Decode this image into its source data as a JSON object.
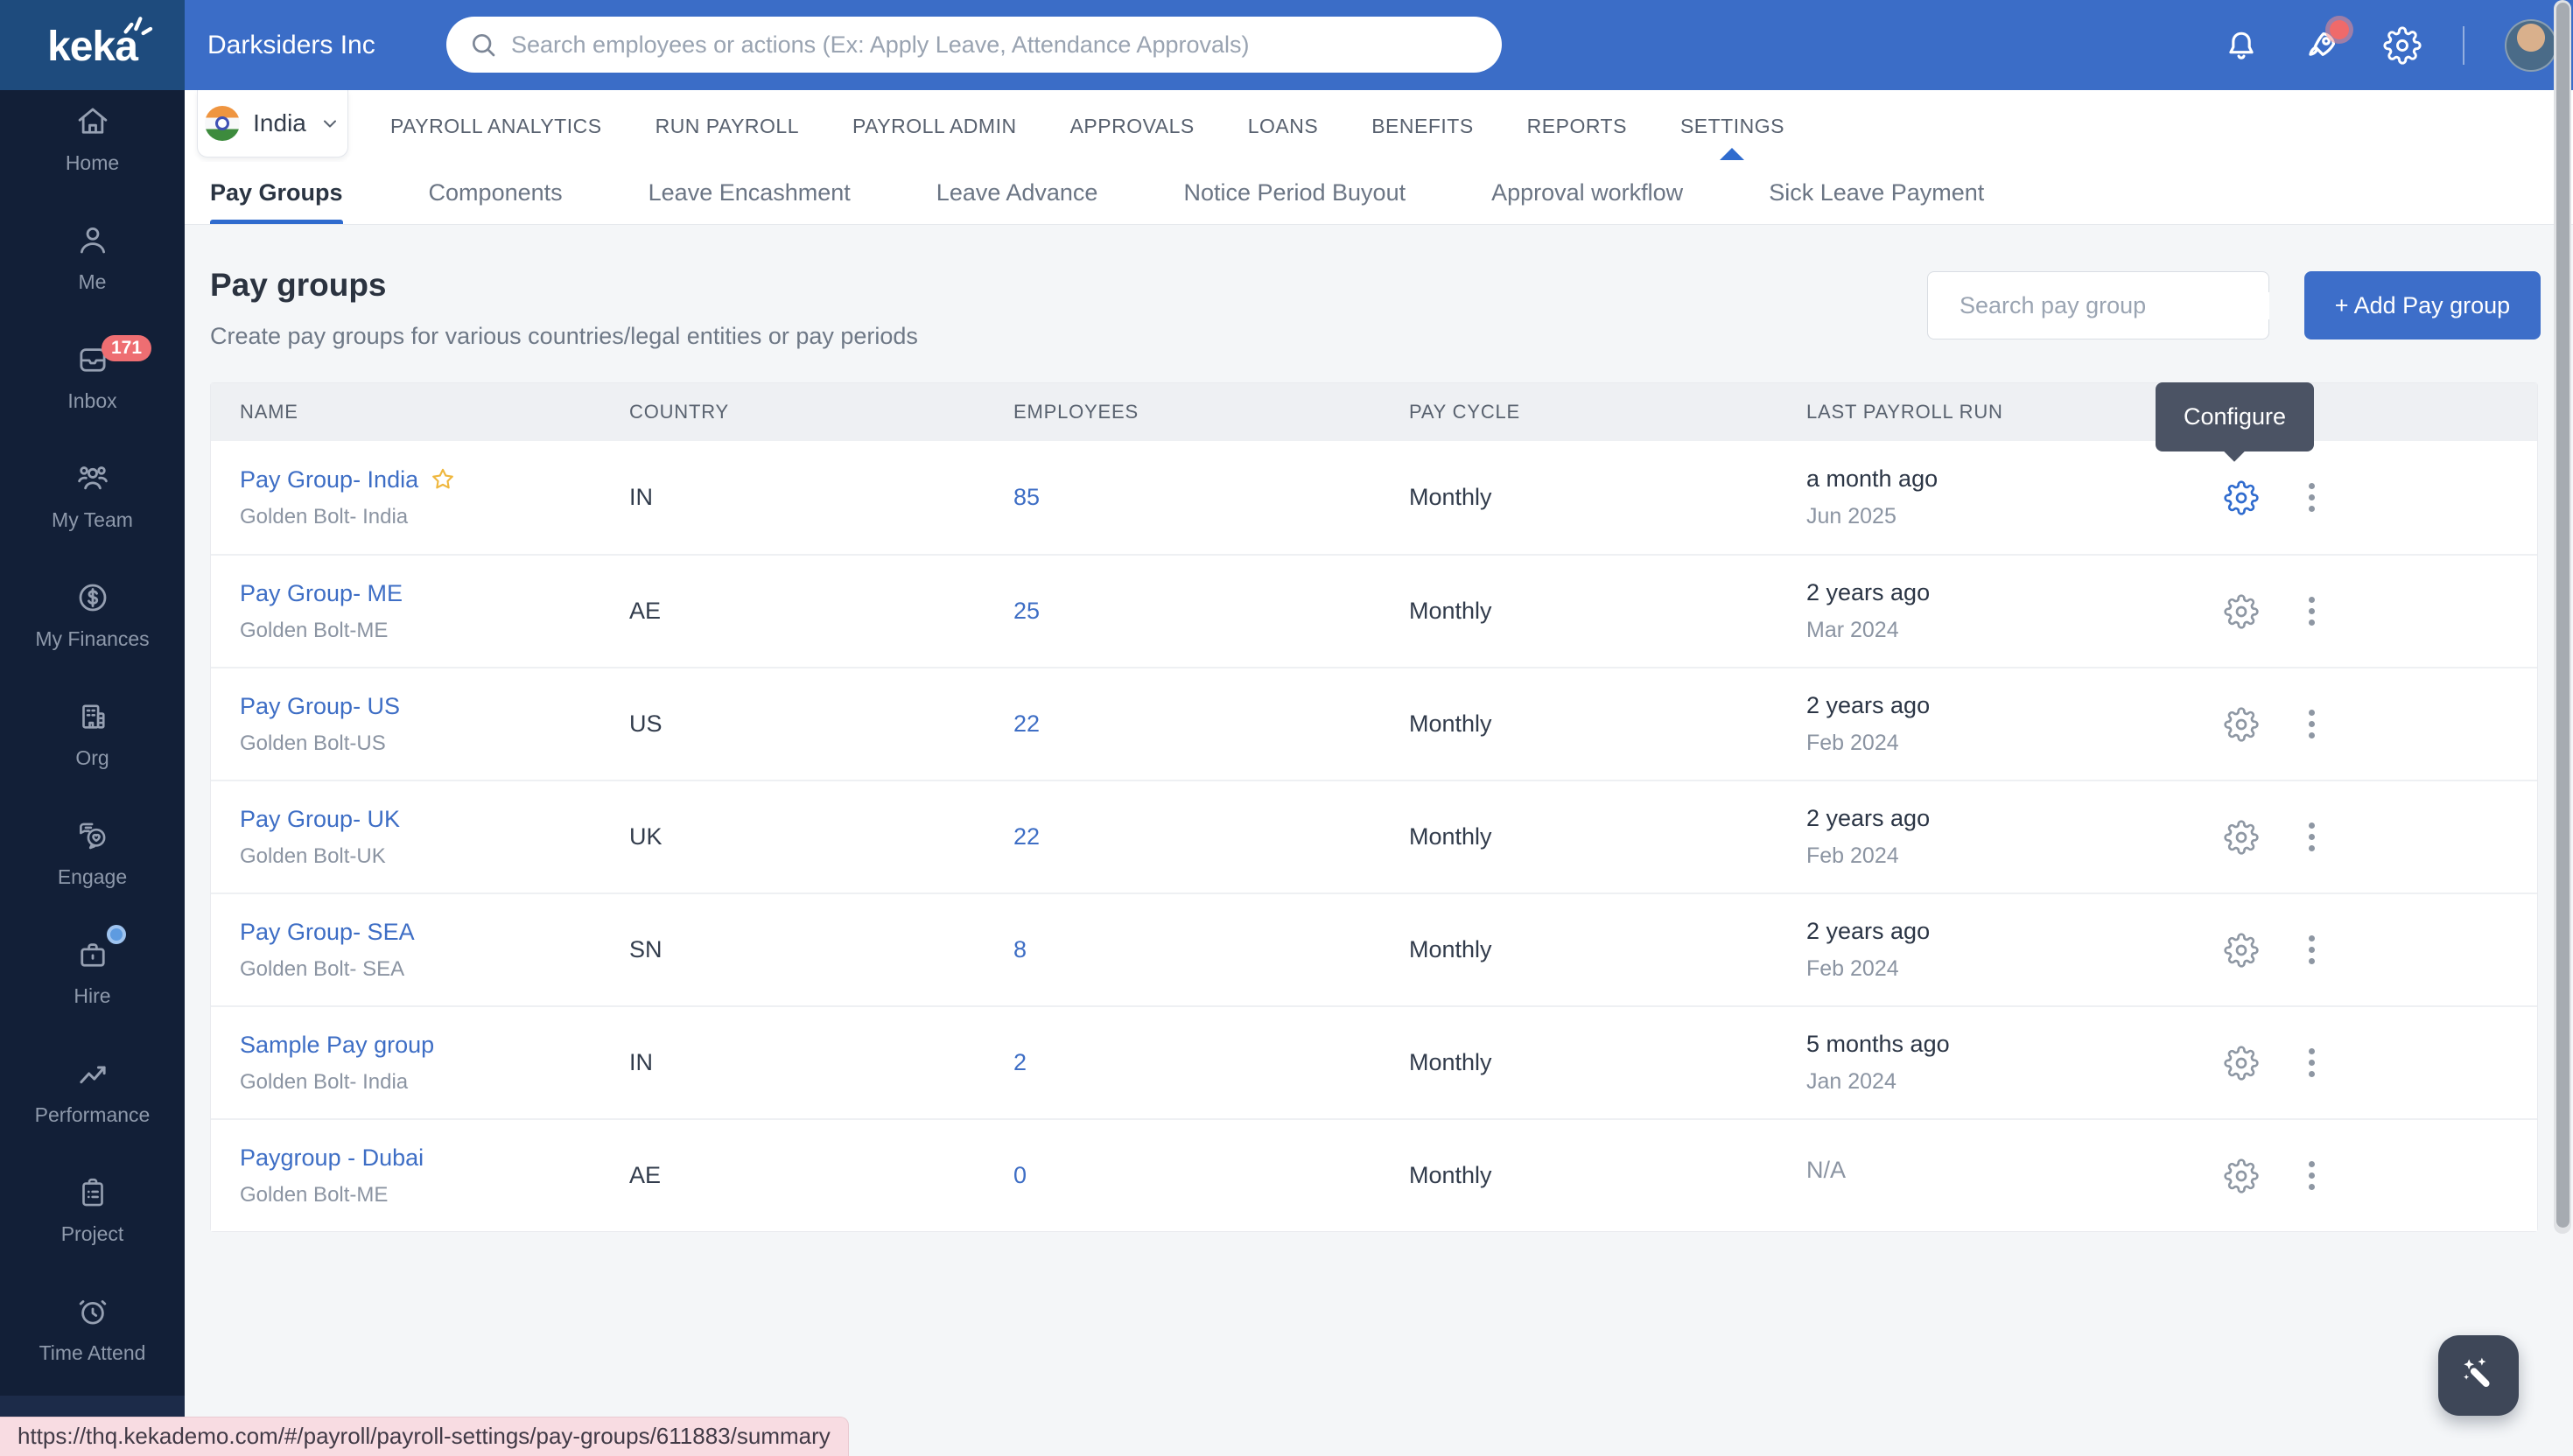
{
  "header": {
    "logo_text": "keka",
    "company": "Darksiders Inc",
    "search_placeholder": "Search employees or actions (Ex: Apply Leave, Attendance Approvals)"
  },
  "sidebar": {
    "items": [
      {
        "label": "Home"
      },
      {
        "label": "Me"
      },
      {
        "label": "Inbox",
        "badge": "171"
      },
      {
        "label": "My Team"
      },
      {
        "label": "My Finances"
      },
      {
        "label": "Org"
      },
      {
        "label": "Engage"
      },
      {
        "label": "Hire"
      },
      {
        "label": "Performance"
      },
      {
        "label": "Project"
      },
      {
        "label": "Time Attend"
      }
    ]
  },
  "module_nav": {
    "country": "India",
    "items": [
      "PAYROLL ANALYTICS",
      "RUN PAYROLL",
      "PAYROLL ADMIN",
      "APPROVALS",
      "LOANS",
      "BENEFITS",
      "REPORTS",
      "SETTINGS"
    ],
    "active": "SETTINGS"
  },
  "subtabs": {
    "items": [
      "Pay Groups",
      "Components",
      "Leave Encashment",
      "Leave Advance",
      "Notice Period Buyout",
      "Approval workflow",
      "Sick Leave Payment"
    ],
    "active": "Pay Groups"
  },
  "page": {
    "title": "Pay groups",
    "subtitle": "Create pay groups for various countries/legal entities or pay periods",
    "search_placeholder": "Search pay group",
    "add_button": "+ Add Pay group"
  },
  "table": {
    "columns": [
      "NAME",
      "COUNTRY",
      "EMPLOYEES",
      "PAY CYCLE",
      "LAST PAYROLL RUN"
    ],
    "rows": [
      {
        "name": "Pay Group- India",
        "entity": "Golden Bolt- India",
        "country": "IN",
        "employees": "85",
        "pay_cycle": "Monthly",
        "run_rel": "a month ago",
        "run_date": "Jun 2025",
        "starred": true,
        "gear_active": true
      },
      {
        "name": "Pay Group- ME",
        "entity": "Golden Bolt-ME",
        "country": "AE",
        "employees": "25",
        "pay_cycle": "Monthly",
        "run_rel": "2 years ago",
        "run_date": "Mar 2024"
      },
      {
        "name": "Pay Group- US",
        "entity": "Golden Bolt-US",
        "country": "US",
        "employees": "22",
        "pay_cycle": "Monthly",
        "run_rel": "2 years ago",
        "run_date": "Feb 2024"
      },
      {
        "name": "Pay Group- UK",
        "entity": "Golden Bolt-UK",
        "country": "UK",
        "employees": "22",
        "pay_cycle": "Monthly",
        "run_rel": "2 years ago",
        "run_date": "Feb 2024"
      },
      {
        "name": "Pay Group- SEA",
        "entity": "Golden Bolt- SEA",
        "country": "SN",
        "employees": "8",
        "pay_cycle": "Monthly",
        "run_rel": "2 years ago",
        "run_date": "Feb 2024"
      },
      {
        "name": "Sample Pay group",
        "entity": "Golden Bolt- India",
        "country": "IN",
        "employees": "2",
        "pay_cycle": "Monthly",
        "run_rel": "5 months ago",
        "run_date": "Jan 2024"
      },
      {
        "name": "Paygroup - Dubai",
        "entity": "Golden Bolt-ME",
        "country": "AE",
        "employees": "0",
        "pay_cycle": "Monthly",
        "run_rel": "N/A",
        "run_date": "",
        "muted": true
      }
    ]
  },
  "tooltip": {
    "label": "Configure"
  },
  "statusbar": {
    "url": "https://thq.kekademo.com/#/payroll/payroll-settings/pay-groups/611883/summary"
  },
  "colors": {
    "header_blue": "#3b6dc7",
    "logo_navy": "#1e4b7d",
    "sidebar_navy": "#121f37",
    "accent_blue": "#2f6bce",
    "link_blue": "#3e6ec5",
    "badge_red": "#ee6e72",
    "tooltip_bg": "#4b5364",
    "page_bg": "#f4f6f8"
  }
}
